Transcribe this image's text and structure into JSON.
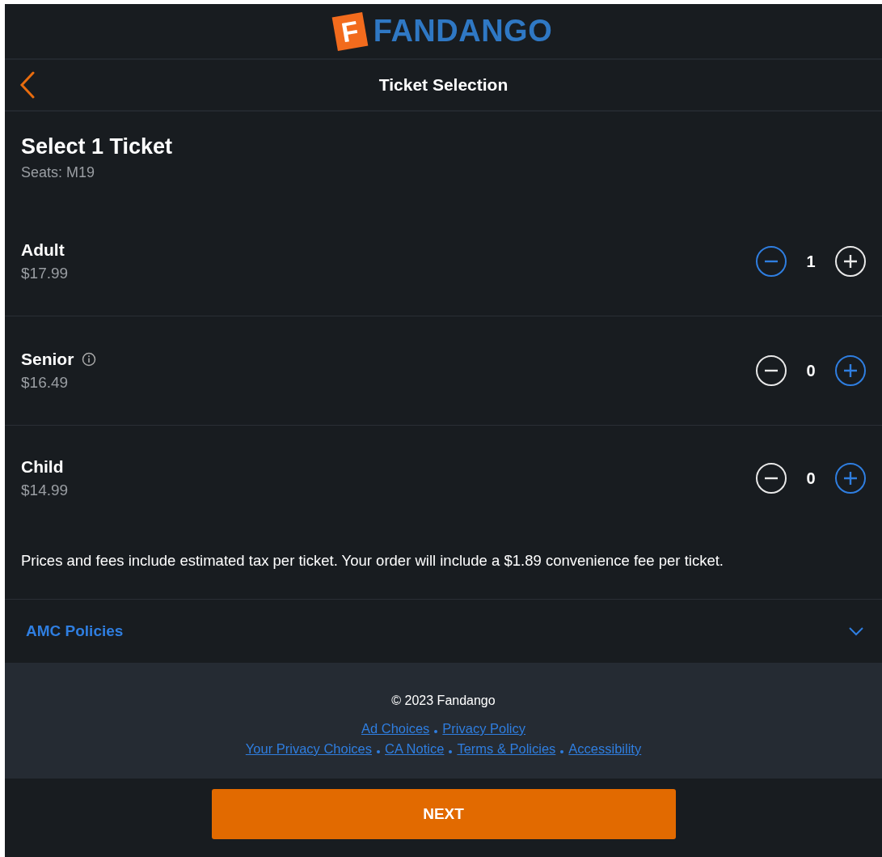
{
  "logo": {
    "mark": "F",
    "name": "FANDANGO"
  },
  "nav": {
    "title": "Ticket Selection"
  },
  "heading": {
    "title": "Select 1 Ticket",
    "seats": "Seats: M19"
  },
  "tickets": [
    {
      "name": "Adult",
      "price": "$17.99",
      "info": false,
      "count": "1",
      "minus_disabled": false,
      "plus_disabled": true
    },
    {
      "name": "Senior",
      "price": "$16.49",
      "info": true,
      "count": "0",
      "minus_disabled": true,
      "plus_disabled": false
    },
    {
      "name": "Child",
      "price": "$14.99",
      "info": false,
      "count": "0",
      "minus_disabled": true,
      "plus_disabled": false
    }
  ],
  "note": "Prices and fees include estimated tax per ticket. Your order will include a $1.89 convenience fee per ticket.",
  "policies": {
    "label": "AMC Policies",
    "expanded": false
  },
  "footer": {
    "copyright": "© 2023 Fandango",
    "link_rows": [
      [
        "Ad Choices",
        "Privacy Policy"
      ],
      [
        "Your Privacy Choices",
        "CA Notice",
        "Terms & Policies",
        "Accessibility"
      ]
    ]
  },
  "next_button": "NEXT"
}
